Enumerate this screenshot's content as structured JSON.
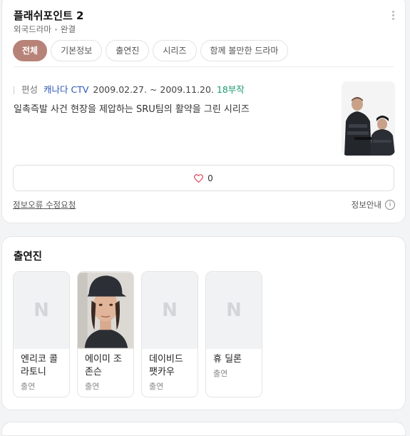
{
  "header": {
    "title": "플래쉬포인트 2",
    "category": "외국드라마",
    "status": "완결"
  },
  "tabs": [
    "전체",
    "기본정보",
    "출연진",
    "시리즈",
    "함께 볼만한 드라마"
  ],
  "info": {
    "label": "편성",
    "network": "캐나다 CTV",
    "period": "2009.02.27. ~ 2009.11.20.",
    "episodes": "18부작",
    "description": "일촉즉발 사건 현장을 제압하는 SRU팀의 활약을 그린 시리즈"
  },
  "like": {
    "count": "0"
  },
  "footer": {
    "report": "정보오류 수정요청",
    "info": "정보안내"
  },
  "cast": {
    "title": "출연진",
    "people": [
      {
        "name": "엔리코 콜라토니",
        "role": "출연",
        "placeholder": "N"
      },
      {
        "name": "에이미 조 존슨",
        "role": "출연"
      },
      {
        "name": "데이비드 팻카우",
        "role": "출연",
        "placeholder": "N"
      },
      {
        "name": "휴 딜론",
        "role": "출연",
        "placeholder": "N"
      }
    ]
  },
  "colors": {
    "accent": "#b78378",
    "network": "#2a57b8",
    "episodes": "#1b9a6c"
  }
}
